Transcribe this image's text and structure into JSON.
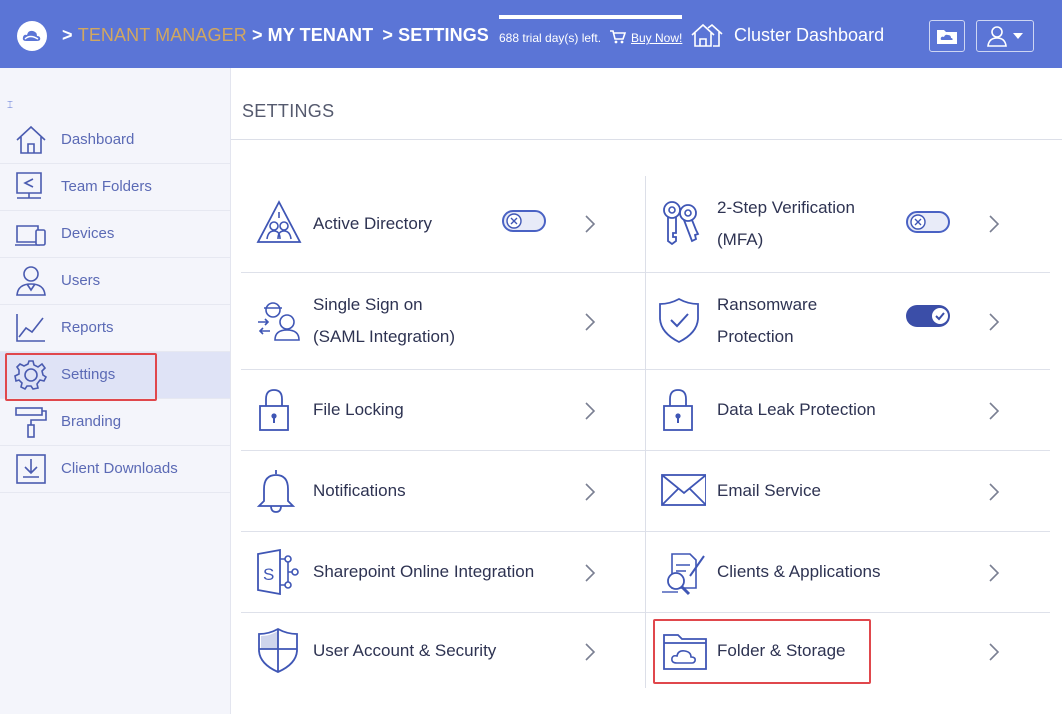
{
  "header": {
    "breadcrumb": [
      {
        "sep": ">",
        "label": "TENANT MANAGER"
      },
      {
        "sep": ">",
        "label": "MY TENANT"
      },
      {
        "sep": ">",
        "label": "SETTINGS"
      }
    ],
    "trial_text": "688 trial day(s) left.",
    "buy_now": "Buy Now!",
    "cluster_dashboard": "Cluster Dashboard",
    "trial_progress": 1.0
  },
  "sidebar": {
    "items": [
      {
        "label": "Dashboard",
        "icon": "house-icon"
      },
      {
        "label": "Team Folders",
        "icon": "shared-folder-icon"
      },
      {
        "label": "Devices",
        "icon": "devices-icon"
      },
      {
        "label": "Users",
        "icon": "user-icon"
      },
      {
        "label": "Reports",
        "icon": "chart-icon"
      },
      {
        "label": "Settings",
        "icon": "gear-icon",
        "active": true
      },
      {
        "label": "Branding",
        "icon": "paint-roller-icon"
      },
      {
        "label": "Client Downloads",
        "icon": "download-icon"
      }
    ]
  },
  "main": {
    "title": "SETTINGS",
    "left_tiles": [
      {
        "label": "Active Directory",
        "icon": "directory-icon",
        "toggle": "off"
      },
      {
        "label_line1": "Single Sign on",
        "label_line2": "(SAML Integration)",
        "icon": "sso-icon"
      },
      {
        "label": "File Locking",
        "icon": "lock-icon"
      },
      {
        "label": "Notifications",
        "icon": "bell-icon"
      },
      {
        "label": "Sharepoint Online Integration",
        "icon": "sharepoint-icon"
      },
      {
        "label": "User Account & Security",
        "icon": "shield-icon"
      }
    ],
    "right_tiles": [
      {
        "label_line1": "2-Step Verification",
        "label_line2": "(MFA)",
        "icon": "keys-icon",
        "toggle": "off"
      },
      {
        "label_line1": "Ransomware",
        "label_line2": "Protection",
        "icon": "shield-check-icon",
        "toggle": "on"
      },
      {
        "label": "Data Leak Protection",
        "icon": "lock-icon"
      },
      {
        "label": "Email Service",
        "icon": "envelope-icon"
      },
      {
        "label": "Clients & Applications",
        "icon": "apps-icon"
      },
      {
        "label": "Folder & Storage",
        "icon": "cloud-folder-icon"
      }
    ]
  },
  "colors": {
    "header_bg": "#5b75d6",
    "accent": "#5b75d6",
    "highlight": "#e0474c",
    "breadcrumb_gold": "#d1a760"
  }
}
